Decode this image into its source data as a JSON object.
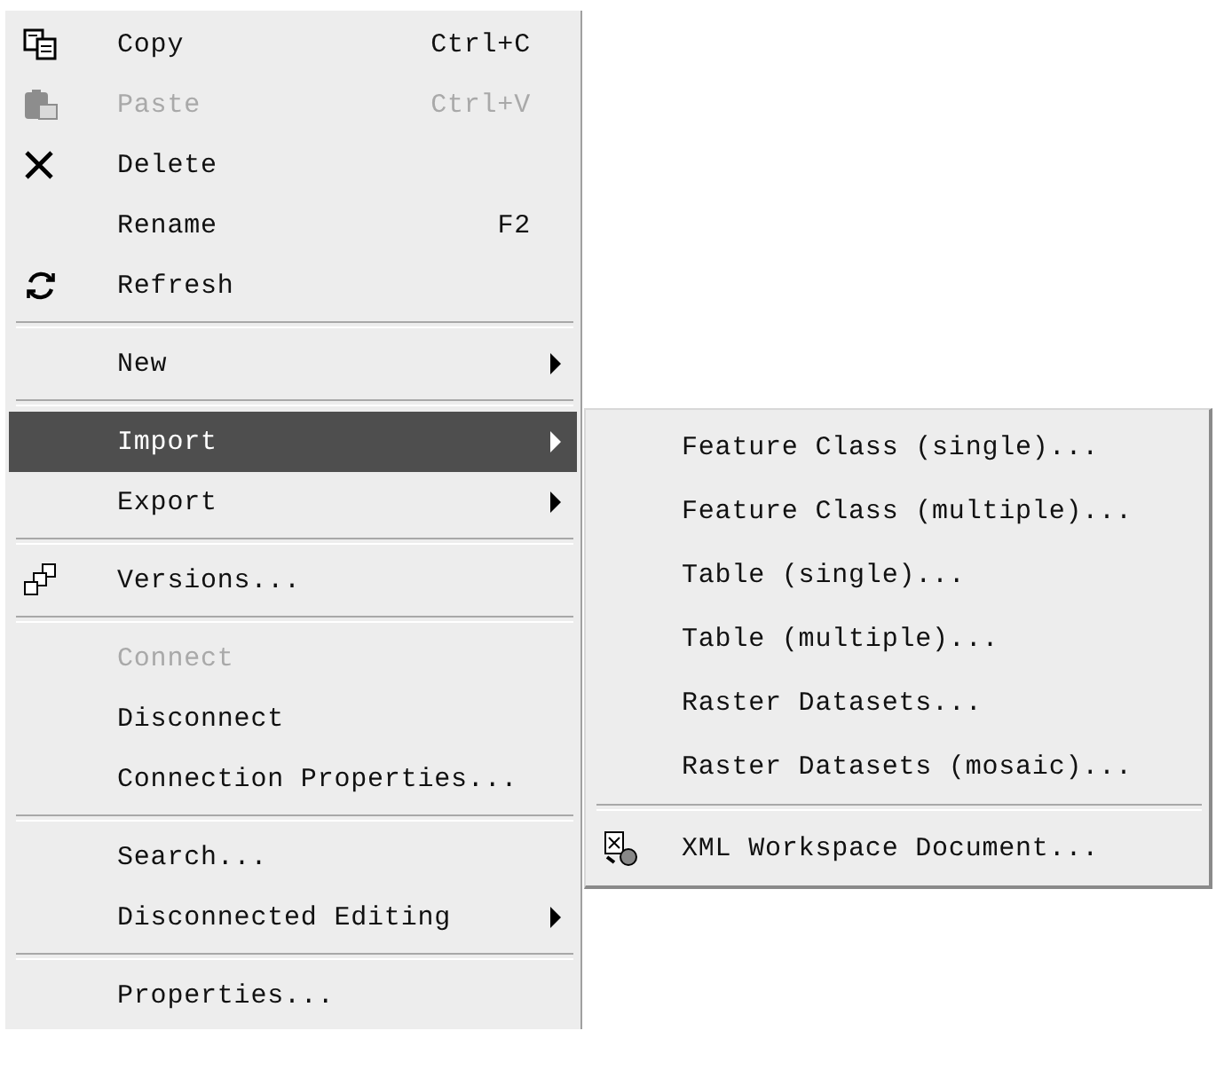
{
  "menu": {
    "items": [
      {
        "kind": "item",
        "label": "Copy",
        "shortcut": "Ctrl+C",
        "disabled": false,
        "selected": false,
        "has_submenu": false
      },
      {
        "kind": "item",
        "label": "Paste",
        "shortcut": "Ctrl+V",
        "disabled": true,
        "selected": false,
        "has_submenu": false
      },
      {
        "kind": "item",
        "label": "Delete",
        "disabled": false,
        "selected": false,
        "has_submenu": false
      },
      {
        "kind": "item",
        "label": "Rename",
        "shortcut": "F2",
        "disabled": false,
        "selected": false,
        "has_submenu": false
      },
      {
        "kind": "item",
        "label": "Refresh",
        "disabled": false,
        "selected": false,
        "has_submenu": false
      },
      {
        "kind": "separator"
      },
      {
        "kind": "item",
        "label": "New",
        "disabled": false,
        "selected": false,
        "has_submenu": true
      },
      {
        "kind": "separator"
      },
      {
        "kind": "item",
        "label": "Import",
        "disabled": false,
        "selected": true,
        "has_submenu": true,
        "submenu": {
          "items": [
            {
              "kind": "item",
              "label": "Feature Class (single)...",
              "disabled": false,
              "selected": false
            },
            {
              "kind": "item",
              "label": "Feature Class (multiple)...",
              "disabled": false,
              "selected": false
            },
            {
              "kind": "item",
              "label": "Table (single)...",
              "disabled": false,
              "selected": false
            },
            {
              "kind": "item",
              "label": "Table (multiple)...",
              "disabled": false,
              "selected": false
            },
            {
              "kind": "item",
              "label": "Raster Datasets...",
              "disabled": false,
              "selected": false
            },
            {
              "kind": "item",
              "label": "Raster Datasets (mosaic)...",
              "disabled": false,
              "selected": false
            },
            {
              "kind": "separator"
            },
            {
              "kind": "item",
              "label": "XML Workspace Document...",
              "disabled": false,
              "selected": false
            }
          ]
        }
      },
      {
        "kind": "item",
        "label": "Export",
        "disabled": false,
        "selected": false,
        "has_submenu": true
      },
      {
        "kind": "separator"
      },
      {
        "kind": "item",
        "label": "Versions...",
        "disabled": false,
        "selected": false,
        "has_submenu": false
      },
      {
        "kind": "separator"
      },
      {
        "kind": "item",
        "label": "Connect",
        "disabled": true,
        "selected": false,
        "has_submenu": false
      },
      {
        "kind": "item",
        "label": "Disconnect",
        "disabled": false,
        "selected": false,
        "has_submenu": false
      },
      {
        "kind": "item",
        "label": "Connection Properties...",
        "disabled": false,
        "selected": false,
        "has_submenu": false
      },
      {
        "kind": "separator"
      },
      {
        "kind": "item",
        "label": "Search...",
        "disabled": false,
        "selected": false,
        "has_submenu": false
      },
      {
        "kind": "item",
        "label": "Disconnected Editing",
        "disabled": false,
        "selected": false,
        "has_submenu": true
      },
      {
        "kind": "separator"
      },
      {
        "kind": "item",
        "label": "Properties...",
        "disabled": false,
        "selected": false,
        "has_submenu": false
      }
    ]
  }
}
